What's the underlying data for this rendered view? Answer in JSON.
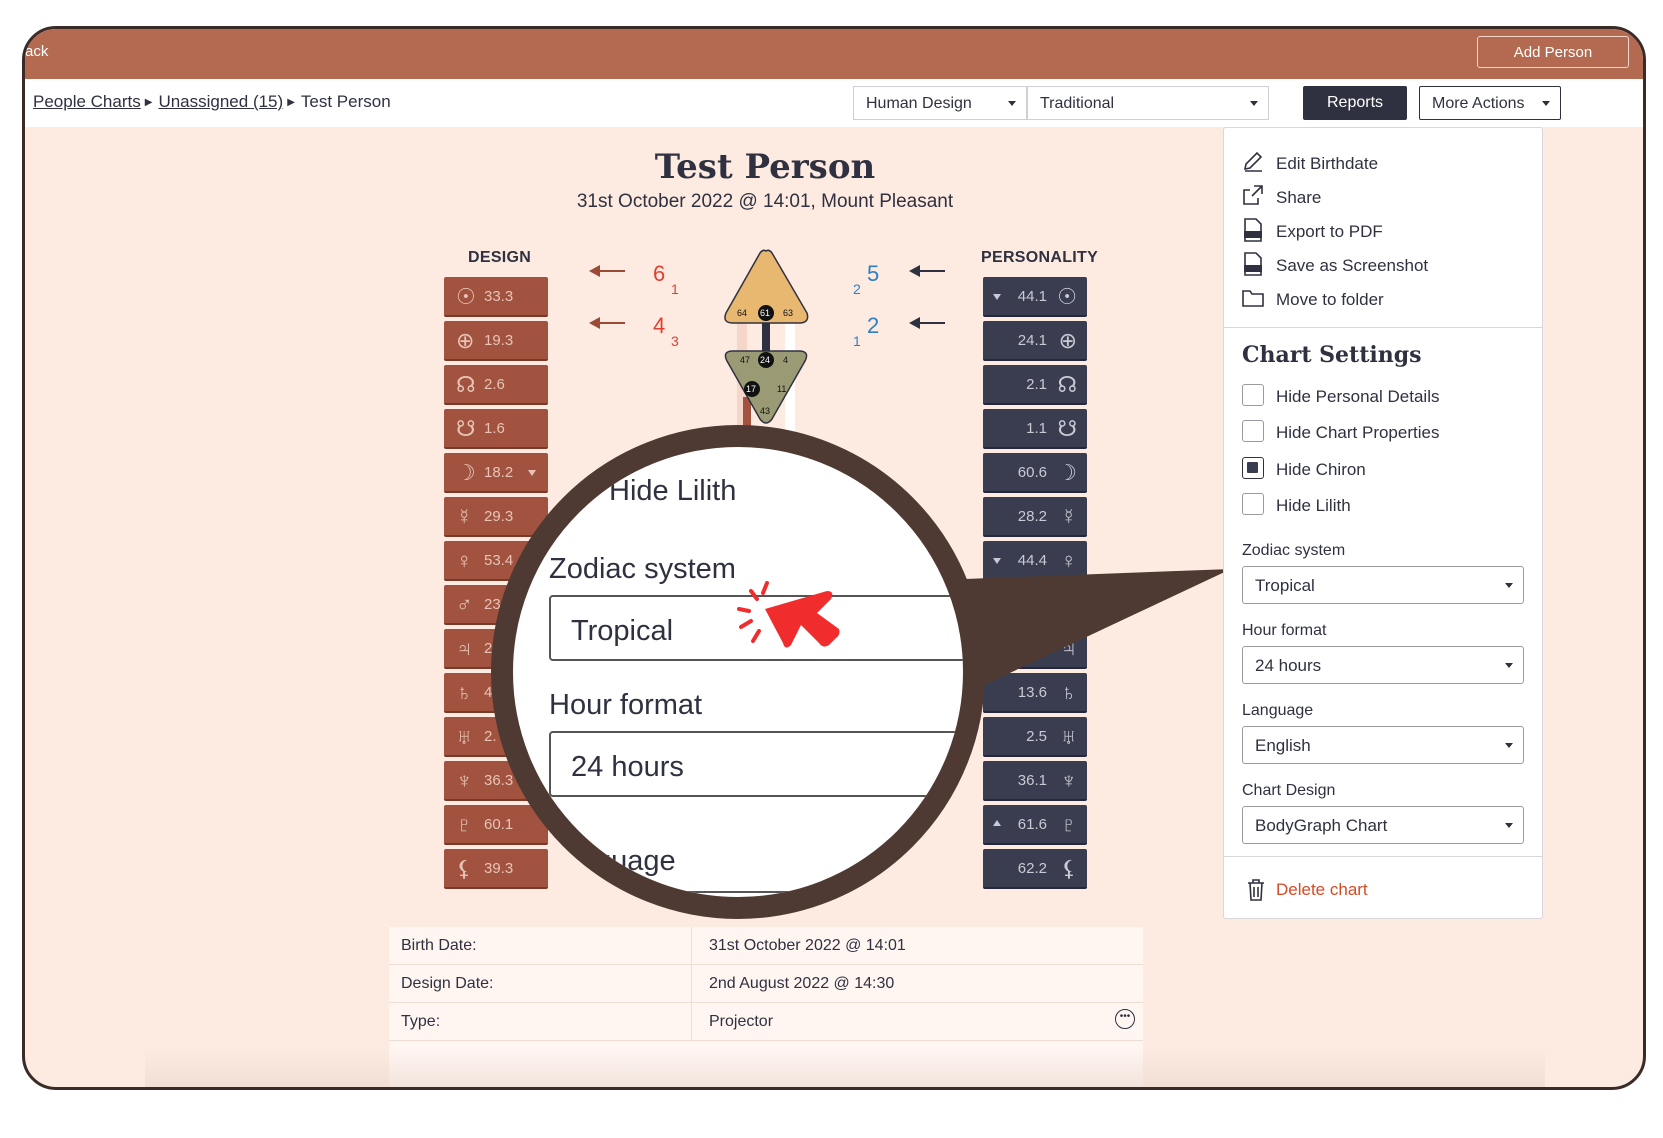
{
  "topbar": {
    "back_label": "Back",
    "add_person_label": "Add Person"
  },
  "breadcrumb": {
    "people_charts": "People Charts",
    "unassigned": "Unassigned (15)",
    "current": "Test Person"
  },
  "toolbar": {
    "system_select": "Human Design",
    "style_select": "Traditional",
    "reports_label": "Reports",
    "more_actions_label": "More Actions"
  },
  "chart": {
    "title": "Test Person",
    "subtitle": "31st October 2022 @ 14:01, Mount Pleasant",
    "design_label": "DESIGN",
    "personality_label": "PERSONALITY",
    "design_activations": [
      {
        "icon": "sun-icon",
        "glyph": "☉",
        "value": "33.3"
      },
      {
        "icon": "earth-icon",
        "glyph": "⊕",
        "value": "19.3"
      },
      {
        "icon": "north-node-icon",
        "glyph": "☊",
        "value": "2.6"
      },
      {
        "icon": "south-node-icon",
        "glyph": "☋",
        "value": "1.6"
      },
      {
        "icon": "moon-icon",
        "glyph": "☽",
        "value": "18.2"
      },
      {
        "icon": "mercury-icon",
        "glyph": "☿",
        "value": "29.3"
      },
      {
        "icon": "venus-icon",
        "glyph": "♀",
        "value": "53.4"
      },
      {
        "icon": "mars-icon",
        "glyph": "♂",
        "value": "23"
      },
      {
        "icon": "jupiter-icon",
        "glyph": "♃",
        "value": "2"
      },
      {
        "icon": "saturn-icon",
        "glyph": "♄",
        "value": "4"
      },
      {
        "icon": "uranus-icon",
        "glyph": "♅",
        "value": "2."
      },
      {
        "icon": "neptune-icon",
        "glyph": "♆",
        "value": "36.3"
      },
      {
        "icon": "pluto-icon",
        "glyph": "♇",
        "value": "60.1"
      },
      {
        "icon": "chiron-icon",
        "glyph": "⚸",
        "value": "39.3"
      }
    ],
    "personality_activations": [
      {
        "icon": "sun-icon",
        "glyph": "☉",
        "value": "44.1"
      },
      {
        "icon": "earth-icon",
        "glyph": "⊕",
        "value": "24.1"
      },
      {
        "icon": "north-node-icon",
        "glyph": "☊",
        "value": "2.1"
      },
      {
        "icon": "south-node-icon",
        "glyph": "☋",
        "value": "1.1"
      },
      {
        "icon": "moon-icon",
        "glyph": "☽",
        "value": "60.6"
      },
      {
        "icon": "mercury-icon",
        "glyph": "☿",
        "value": "28.2"
      },
      {
        "icon": "venus-icon",
        "glyph": "♀",
        "value": "44.4"
      },
      {
        "icon": "mars-icon",
        "glyph": "♂",
        "value": ""
      },
      {
        "icon": "jupiter-icon",
        "glyph": "♃",
        "value": ".2"
      },
      {
        "icon": "saturn-icon",
        "glyph": "♄",
        "value": "13.6"
      },
      {
        "icon": "uranus-icon",
        "glyph": "♅",
        "value": "2.5"
      },
      {
        "icon": "neptune-icon",
        "glyph": "♆",
        "value": "36.1"
      },
      {
        "icon": "pluto-icon",
        "glyph": "♇",
        "value": "61.6"
      },
      {
        "icon": "chiron-icon",
        "glyph": "⚸",
        "value": "62.2"
      }
    ],
    "variables": {
      "left_top": {
        "num": "6",
        "sub": "1"
      },
      "left_bottom": {
        "num": "4",
        "sub": "3"
      },
      "right_top": {
        "num": "5",
        "sub": "2"
      },
      "right_bottom": {
        "num": "2",
        "sub": "1"
      }
    },
    "head_gates": [
      "64",
      "61",
      "63"
    ],
    "ajna_gates": [
      "47",
      "24",
      "4",
      "17",
      "11",
      "43"
    ]
  },
  "magnifier": {
    "hide_lilith": "Hide Lilith",
    "zodiac_label": "Zodiac system",
    "zodiac_value": "Tropical",
    "hour_label": "Hour format",
    "hour_value": "24 hours",
    "language_partial": "guage"
  },
  "details": {
    "rows": [
      {
        "label": "Birth Date:",
        "value": "31st October 2022 @ 14:01"
      },
      {
        "label": "Design Date:",
        "value": "2nd August 2022 @ 14:30"
      },
      {
        "label": "Type:",
        "value": "Projector"
      }
    ]
  },
  "panel": {
    "menu": [
      {
        "icon": "pencil-icon",
        "label": "Edit Birthdate"
      },
      {
        "icon": "share-icon",
        "label": "Share"
      },
      {
        "icon": "pdf-icon",
        "label": "Export to PDF"
      },
      {
        "icon": "png-icon",
        "label": "Save as Screenshot"
      },
      {
        "icon": "folder-icon",
        "label": "Move to folder"
      }
    ],
    "settings_title": "Chart Settings",
    "checkboxes": [
      {
        "label": "Hide Personal Details",
        "checked": false
      },
      {
        "label": "Hide Chart Properties",
        "checked": false
      },
      {
        "label": "Hide Chiron",
        "checked": true
      },
      {
        "label": "Hide Lilith",
        "checked": false
      }
    ],
    "zodiac_label": "Zodiac system",
    "zodiac_value": "Tropical",
    "hour_label": "Hour format",
    "hour_value": "24 hours",
    "language_label": "Language",
    "language_value": "English",
    "design_label": "Chart Design",
    "design_value": "BodyGraph Chart",
    "delete_label": "Delete chart"
  },
  "colors": {
    "brand": "#b46a50",
    "design": "#a1533f",
    "personality": "#3a3d4f",
    "pointer": "#f02c2c",
    "danger": "#d64a24"
  }
}
